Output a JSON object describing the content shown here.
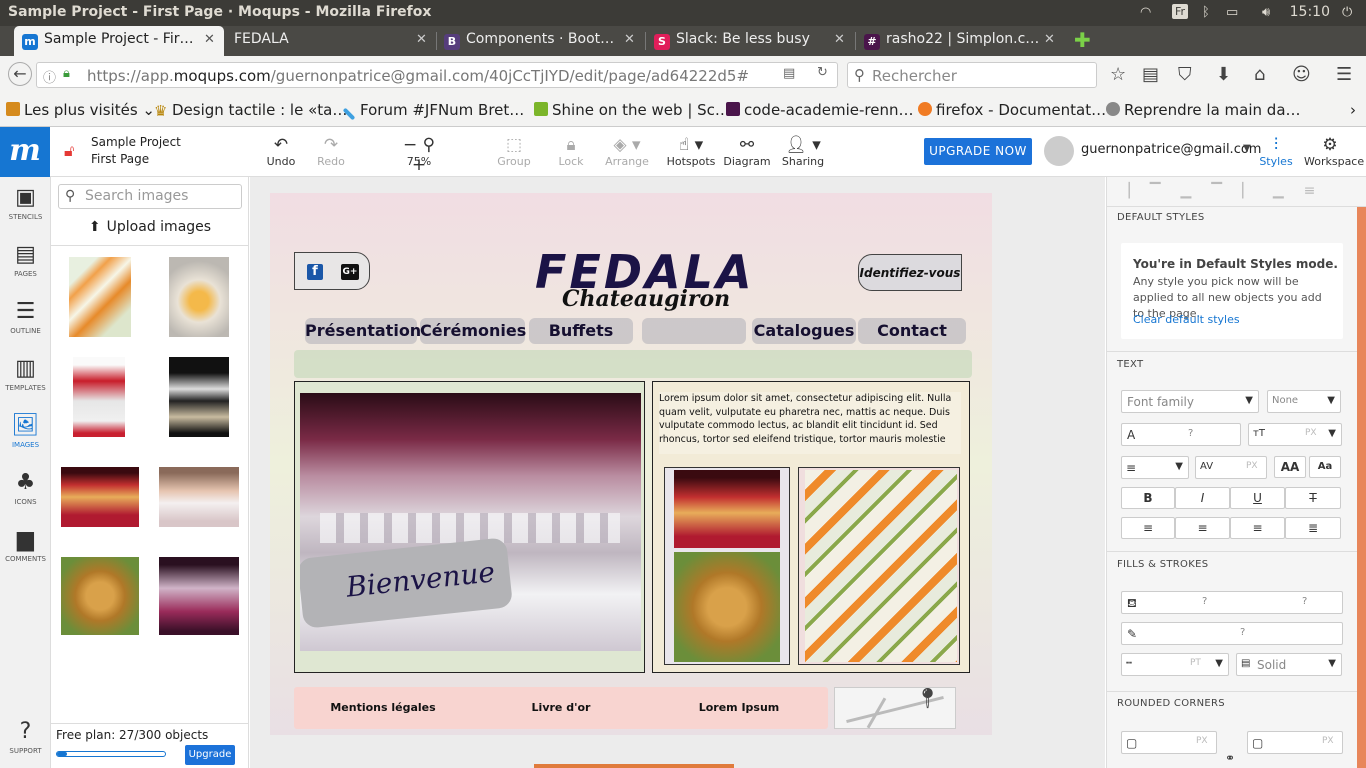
{
  "os": {
    "window_title": "Sample Project - First Page · Moqups - Mozilla Firefox",
    "keyboard": "Fr",
    "time": "15:10"
  },
  "tabs": [
    {
      "label": "Sample Project - Fir…",
      "icon": "m",
      "icon_color": "#1676d2"
    },
    {
      "label": "FEDALA"
    },
    {
      "label": "Components · Boot…",
      "icon": "B",
      "icon_color": "#563d7c"
    },
    {
      "label": "Slack: Be less busy",
      "icon": "S",
      "icon_color": "#e01e5a"
    },
    {
      "label": "rasho22 | Simplon.c…",
      "icon": "#",
      "icon_color": "#4a154b"
    }
  ],
  "url": {
    "prefix": "https://app.",
    "domain": "moqups.com",
    "rest": "/guernonpatrice@gmail.com/40jCcTjIYD/edit/page/ad64222d5#"
  },
  "search_placeholder": "Rechercher",
  "bookmarks": [
    "Les plus visités ⌄",
    "Design tactile : le «ta…",
    "Forum #JFNum Bret…",
    "Shine on the web | Sc…",
    "code-academie-renn…",
    "firefox - Documentat…",
    "Reprendre la main da…"
  ],
  "project": {
    "name": "Sample Project",
    "page": "First Page"
  },
  "toolbar": {
    "undo": "Undo",
    "redo": "Redo",
    "zoom": "75%",
    "group": "Group",
    "lock": "Lock",
    "arrange": "Arrange",
    "hotspots": "Hotspots",
    "diagram": "Diagram",
    "sharing": "Sharing",
    "upgrade": "UPGRADE NOW",
    "user": "guernonpatrice@gmail.com",
    "styles": "Styles",
    "workspace": "Workspace"
  },
  "rail": [
    "STENCILS",
    "PAGES",
    "OUTLINE",
    "TEMPLATES",
    "IMAGES",
    "ICONS",
    "COMMENTS",
    "SUPPORT"
  ],
  "images_panel": {
    "search_placeholder": "Search images",
    "upload": "Upload images",
    "plan": "Free plan: 27/300 objects",
    "plan_fraction": 0.09,
    "upgrade": "Upgrade"
  },
  "mockup": {
    "brand": "FEDALA",
    "sub": "Chateaugiron",
    "login": "Identifiez-vous",
    "nav": [
      "Présentation",
      "Cérémonies",
      "Buffets",
      "",
      "Catalogues",
      "Contact"
    ],
    "welcome": "Bienvenue",
    "lorem": "Lorem ipsum dolor sit amet, consectetur adipiscing elit. Nulla quam velit, vulputate eu pharetra nec, mattis ac neque. Duis vulputate commodo lectus, ac blandit elit tincidunt id. Sed rhoncus, tortor sed eleifend tristique, tortor mauris molestie",
    "footer": [
      "Mentions légales",
      "Livre d'or",
      "Lorem Ipsum"
    ]
  },
  "styles": {
    "default_title": "DEFAULT STYLES",
    "default_heading": "You're in Default Styles mode.",
    "default_body": "Any style you pick now will be applied to all new objects you add to the page.",
    "clear": "Clear default styles",
    "text_title": "TEXT",
    "font_family": "Font family",
    "none": "None",
    "q": "?",
    "px": "PX",
    "pt": "PT",
    "fills_title": "FILLS & STROKES",
    "solid": "Solid",
    "corners_title": "ROUNDED CORNERS",
    "aa_large": "AA",
    "aa_small": "Aa",
    "bold": "B",
    "italic": "I",
    "underline": "U",
    "strike": "T"
  }
}
